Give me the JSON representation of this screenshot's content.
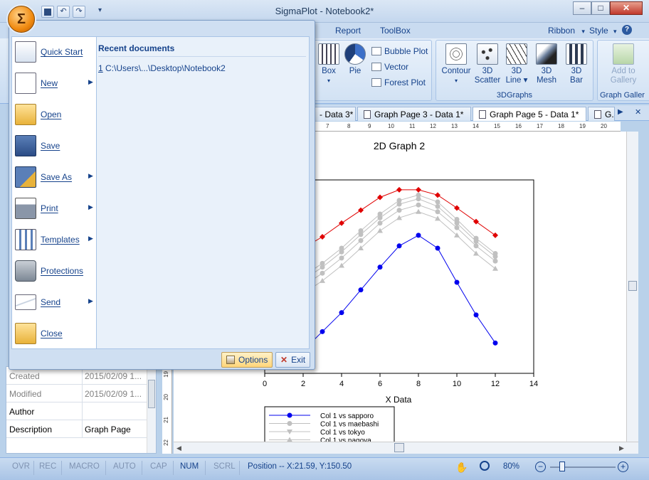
{
  "window": {
    "title": "SigmaPlot - Notebook2*",
    "orb_glyph": "Σ",
    "minimize": "–",
    "maximize": "□",
    "close": "✕",
    "qat": {
      "save": "save-icon",
      "undo": "↶",
      "redo": "↷",
      "more": "▾"
    }
  },
  "ribbon": {
    "tabs": [
      "Report",
      "ToolBox"
    ],
    "right": {
      "ribbon_label": "Ribbon",
      "ribbon_chev": "▾",
      "style_label": "Style",
      "style_chev": "▾",
      "help": "?"
    },
    "partial_group": {
      "box": "Box",
      "box_chev": "▾",
      "pie": "Pie",
      "bubble": "Bubble Plot",
      "vector": "Vector",
      "forest": "Forest Plot"
    },
    "group_3d": {
      "label": "3DGraphs",
      "buttons": [
        {
          "label": "Contour",
          "sub": "▾"
        },
        {
          "label": "3D",
          "sub": "Scatter"
        },
        {
          "label": "3D",
          "sub": "Line ▾"
        },
        {
          "label": "3D",
          "sub": "Mesh"
        },
        {
          "label": "3D",
          "sub": "Bar"
        }
      ]
    },
    "group_gallery": {
      "label": "Graph Galler",
      "button_line1": "Add to",
      "button_line2": "Gallery"
    }
  },
  "doc_tabs": [
    {
      "label": "- Data 3*"
    },
    {
      "label": "Graph Page 3 - Data 1*"
    },
    {
      "label": "Graph Page 5 - Data 1*"
    },
    {
      "label": "G..."
    }
  ],
  "doc_tab_nav": {
    "next": "▶",
    "close": "✕"
  },
  "ruler": {
    "ticks": [
      "7",
      "8",
      "9",
      "10",
      "11",
      "12",
      "13",
      "14",
      "15",
      "16",
      "17",
      "18",
      "19",
      "20"
    ],
    "vticks": [
      "19",
      "20",
      "21",
      "22"
    ]
  },
  "office_menu": {
    "items": [
      {
        "label": "Quick Start",
        "icon": "quick-start-icon",
        "submenu": false
      },
      {
        "label": "New",
        "icon": "new-document-icon",
        "submenu": true
      },
      {
        "label": "Open",
        "icon": "open-folder-icon",
        "submenu": false
      },
      {
        "label": "Save",
        "icon": "save-icon",
        "submenu": false
      },
      {
        "label": "Save As",
        "icon": "save-as-icon",
        "submenu": true
      },
      {
        "label": "Print",
        "icon": "printer-icon",
        "submenu": true
      },
      {
        "label": "Templates",
        "icon": "templates-icon",
        "submenu": true
      },
      {
        "label": "Protections",
        "icon": "lock-icon",
        "submenu": false
      },
      {
        "label": "Send",
        "icon": "envelope-icon",
        "submenu": true
      },
      {
        "label": "Close",
        "icon": "close-folder-icon",
        "submenu": false
      }
    ],
    "chevron": "▶",
    "recent_title": "Recent documents",
    "recent": [
      {
        "index": "1",
        "path": "C:\\Users\\...\\Desktop\\Notebook2"
      }
    ],
    "options_label": "Options",
    "exit_label": "Exit"
  },
  "properties": {
    "rows": [
      {
        "key": "Created",
        "value": "2015/02/09 1...",
        "muted": true
      },
      {
        "key": "Modified",
        "value": "2015/02/09 1...",
        "muted": true
      },
      {
        "key": "Author",
        "value": "",
        "muted": false
      },
      {
        "key": "Description",
        "value": "Graph Page",
        "muted": false
      }
    ]
  },
  "status": {
    "ovr": "OVR",
    "rec": "REC",
    "macro": "MACRO",
    "auto": "AUTO",
    "cap": "CAP",
    "num": "NUM",
    "scrl": "SCRL",
    "position": "Position -- X:21.59, Y:150.50",
    "zoom": "80%",
    "zoom_minus": "−",
    "zoom_plus": "+"
  },
  "chart_data": {
    "type": "line",
    "title": "2D Graph 2",
    "xlabel": "X Data",
    "ylabel": "",
    "xlim": [
      0,
      14
    ],
    "xticks": [
      0,
      2,
      4,
      6,
      8,
      10,
      12,
      14
    ],
    "x": [
      1,
      2,
      3,
      4,
      5,
      6,
      7,
      8,
      9,
      10,
      11,
      12
    ],
    "grid": false,
    "legend_position": "bottom",
    "series": [
      {
        "name": "",
        "color": "#e00000",
        "marker": "diamond",
        "values": [
          3.5,
          4.5,
          6.0,
          7.8,
          9.5,
          11.2,
          12.2,
          12.2,
          11.5,
          9.8,
          8.0,
          6.2
        ]
      },
      {
        "name": "",
        "color": "#c0c0c0",
        "marker": "circle",
        "values": [
          -0.5,
          0.8,
          2.5,
          4.5,
          6.8,
          9.0,
          10.8,
          11.5,
          10.6,
          8.3,
          5.8,
          3.8
        ]
      },
      {
        "name": "",
        "color": "#c0c0c0",
        "marker": "circle",
        "values": [
          -1.0,
          0.3,
          2.0,
          4.0,
          6.3,
          8.5,
          10.3,
          11.0,
          10.0,
          7.8,
          5.4,
          3.4
        ]
      },
      {
        "name": "",
        "color": "#c0c0c0",
        "marker": "circle",
        "values": [
          -1.8,
          -0.5,
          1.2,
          3.2,
          5.5,
          7.8,
          9.5,
          10.2,
          9.3,
          7.2,
          4.8,
          2.8
        ]
      },
      {
        "name": "",
        "color": "#c0c0c0",
        "marker": "triangle",
        "values": [
          -2.8,
          -1.5,
          0.2,
          2.2,
          4.5,
          6.8,
          8.5,
          9.3,
          8.4,
          6.2,
          3.8,
          1.8
        ]
      },
      {
        "name": "",
        "color": "#0000ee",
        "marker": "circle",
        "values": [
          -10.5,
          -9.0,
          -6.5,
          -4.0,
          -1.0,
          2.0,
          4.8,
          6.2,
          4.5,
          0.0,
          -4.3,
          -8.0
        ]
      }
    ],
    "legend": [
      {
        "label": "Col 1 vs sapporo",
        "color": "#0000ee",
        "marker": "circle"
      },
      {
        "label": "Col 1 vs maebashi",
        "color": "#c0c0c0",
        "marker": "circle"
      },
      {
        "label": "Col 1 vs tokyo",
        "color": "#c0c0c0",
        "marker": "triangle-down"
      },
      {
        "label": "Col 1 vs nagoya",
        "color": "#c0c0c0",
        "marker": "triangle"
      }
    ]
  }
}
